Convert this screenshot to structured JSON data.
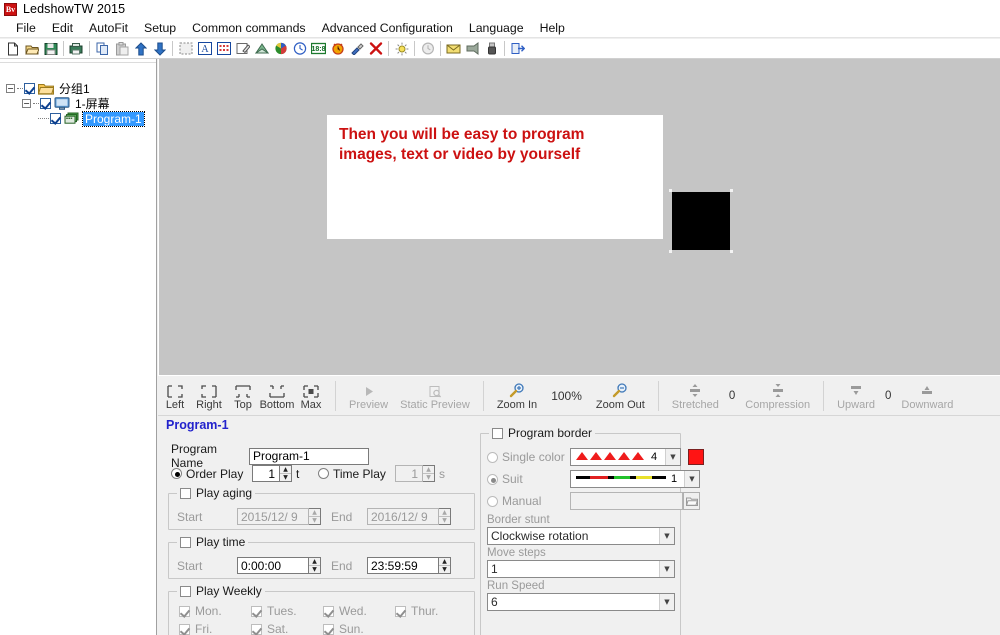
{
  "window": {
    "title": "LedshowTW 2015",
    "app_icon": "led-app-icon"
  },
  "menubar": {
    "items": [
      {
        "label": "File",
        "name": "menu-file"
      },
      {
        "label": "Edit",
        "name": "menu-edit"
      },
      {
        "label": "AutoFit",
        "name": "menu-autofit"
      },
      {
        "label": "Setup",
        "name": "menu-setup"
      },
      {
        "label": "Common commands",
        "name": "menu-common-commands"
      },
      {
        "label": "Advanced Configuration",
        "name": "menu-advanced-configuration"
      },
      {
        "label": "Language",
        "name": "menu-language"
      },
      {
        "label": "Help",
        "name": "menu-help"
      }
    ]
  },
  "toolbar": {
    "buttons": [
      {
        "name": "new-file-icon"
      },
      {
        "name": "open-file-icon"
      },
      {
        "name": "save-file-icon"
      },
      {
        "sep": true
      },
      {
        "name": "print-icon"
      },
      {
        "sep": true
      },
      {
        "name": "copy-icon"
      },
      {
        "name": "paste-icon"
      },
      {
        "name": "move-up-icon"
      },
      {
        "name": "move-down-icon"
      },
      {
        "sep": true
      },
      {
        "name": "add-program-icon"
      },
      {
        "name": "add-text-icon"
      },
      {
        "name": "add-table-icon"
      },
      {
        "name": "add-note-icon"
      },
      {
        "name": "add-picture-icon"
      },
      {
        "name": "color-wheel-icon"
      },
      {
        "name": "clock-icon"
      },
      {
        "name": "counter-icon"
      },
      {
        "name": "timer-icon"
      },
      {
        "name": "effect-icon"
      },
      {
        "name": "delete-icon"
      },
      {
        "sep": true
      },
      {
        "name": "brightness-icon"
      },
      {
        "sep": true
      },
      {
        "name": "time-correct-icon"
      },
      {
        "sep": true
      },
      {
        "name": "send-program-icon"
      },
      {
        "name": "export-icon"
      },
      {
        "name": "usb-icon"
      },
      {
        "sep": true
      },
      {
        "name": "exit-icon"
      }
    ]
  },
  "tree": {
    "nodes": [
      {
        "label": "分组1",
        "name": "tree-node-group1",
        "level": 1,
        "icon": "folder-icon",
        "checked": true,
        "expanded": true,
        "selected": false
      },
      {
        "label": "1-屏幕",
        "name": "tree-node-screen1",
        "level": 2,
        "icon": "monitor-icon",
        "checked": true,
        "expanded": true,
        "selected": false
      },
      {
        "label": "Program-1",
        "name": "tree-node-program1",
        "level": 3,
        "icon": "program-icon",
        "checked": true,
        "expanded": false,
        "selected": true
      }
    ]
  },
  "canvas": {
    "screen_text_line1": "Then you will be easy to program",
    "screen_text_line2": "images, text or video by yourself",
    "screen_text_color": "#cc1111",
    "background_color": "#c5c5c5"
  },
  "viewbar": {
    "align": [
      {
        "label": "Left",
        "name": "align-left-button"
      },
      {
        "label": "Right",
        "name": "align-right-button"
      },
      {
        "label": "Top",
        "name": "align-top-button"
      },
      {
        "label": "Bottom",
        "name": "align-bottom-button"
      },
      {
        "label": "Max",
        "name": "align-max-button"
      }
    ],
    "preview": [
      {
        "label": "Preview",
        "name": "preview-button"
      },
      {
        "label": "Static Preview",
        "name": "static-preview-button"
      }
    ],
    "zoom_in_label": "Zoom In",
    "zoom_level": "100%",
    "zoom_out_label": "Zoom Out",
    "stretched_label": "Stretched",
    "stretched_value": "0",
    "compression_label": "Compression",
    "upward_label": "Upward",
    "updown_value": "0",
    "downward_label": "Downward"
  },
  "properties": {
    "title": "Program-1",
    "program_name_label": "Program Name",
    "program_name_value": "Program-1",
    "order_play_label": "Order Play",
    "order_play_value": "1",
    "order_play_unit": "t",
    "order_play_selected": true,
    "time_play_label": "Time Play",
    "time_play_value": "1",
    "time_play_unit": "s",
    "time_play_selected": false,
    "play_aging": {
      "label": "Play aging",
      "checked": false,
      "start_label": "Start",
      "start_value": "2015/12/ 9",
      "end_label": "End",
      "end_value": "2016/12/ 9"
    },
    "play_time": {
      "label": "Play time",
      "checked": false,
      "start_label": "Start",
      "start_value": "0:00:00",
      "end_label": "End",
      "end_value": "23:59:59"
    },
    "play_weekly": {
      "label": "Play Weekly",
      "checked": false,
      "days": [
        {
          "label": "Mon.",
          "name": "weekday-mon-checkbox",
          "checked": true
        },
        {
          "label": "Tues.",
          "name": "weekday-tues-checkbox",
          "checked": true
        },
        {
          "label": "Wed.",
          "name": "weekday-wed-checkbox",
          "checked": true
        },
        {
          "label": "Thur.",
          "name": "weekday-thur-checkbox",
          "checked": true
        },
        {
          "label": "Fri.",
          "name": "weekday-fri-checkbox",
          "checked": true
        },
        {
          "label": "Sat.",
          "name": "weekday-sat-checkbox",
          "checked": true
        },
        {
          "label": "Sun.",
          "name": "weekday-sun-checkbox",
          "checked": true
        }
      ]
    },
    "program_border": {
      "label": "Program border",
      "checked": false,
      "single_color_label": "Single color",
      "single_color_selected": false,
      "single_color_value": "4",
      "single_color_swatch": "#ff1414",
      "suit_label": "Suit",
      "suit_selected": true,
      "suit_value": "1",
      "manual_label": "Manual",
      "manual_selected": false,
      "manual_value": "",
      "border_stunt_label": "Border stunt",
      "border_stunt_value": "Clockwise rotation",
      "move_steps_label": "Move steps",
      "move_steps_value": "1",
      "run_speed_label": "Run Speed",
      "run_speed_value": "6"
    }
  }
}
